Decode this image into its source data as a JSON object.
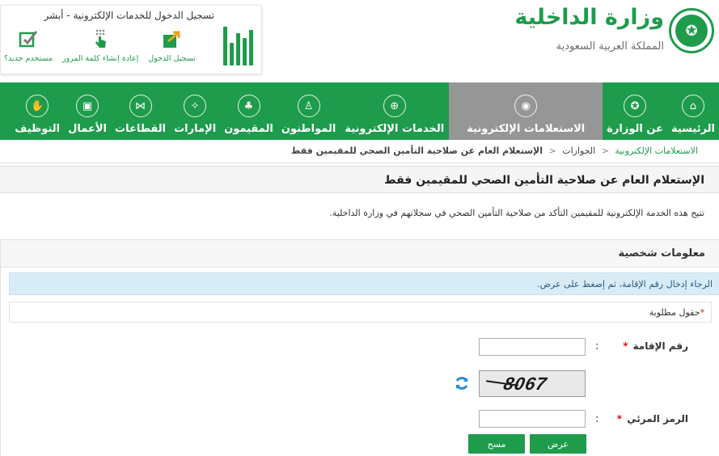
{
  "header": {
    "ministry_title": "وزارة الداخلية",
    "kingdom_title": "المملكة العربية السعودية",
    "absher": {
      "heading": "تسجيل الدخول للخدمات الإلكترونية - أبشر",
      "actions": [
        {
          "label": "مستخدم جديد؟",
          "icon": "new-user-icon"
        },
        {
          "label": "إعادة إنشاء كلمة المرور",
          "icon": "password-reset-icon"
        },
        {
          "label": "تسجيل الدخول",
          "icon": "login-icon"
        }
      ]
    }
  },
  "nav": {
    "items": [
      {
        "label": "الرئيسية",
        "icon": "home-icon",
        "glyph": "⌂",
        "active": false
      },
      {
        "label": "عن الوزارة",
        "icon": "emblem-icon",
        "glyph": "✪",
        "active": false
      },
      {
        "label": "الاستعلامات الإلكترونية",
        "icon": "inquiry-icon",
        "glyph": "◉",
        "active": true
      },
      {
        "label": "الخدمات الإلكترونية",
        "icon": "globe-icon",
        "glyph": "⊕",
        "active": false
      },
      {
        "label": "المواطنون",
        "icon": "citizen-icon",
        "glyph": "♙",
        "active": false
      },
      {
        "label": "المقيمون",
        "icon": "residents-icon",
        "glyph": "♣",
        "active": false
      },
      {
        "label": "الإمارات",
        "icon": "emirates-icon",
        "glyph": "✧",
        "active": false
      },
      {
        "label": "القطاعات",
        "icon": "sectors-icon",
        "glyph": "⋈",
        "active": false
      },
      {
        "label": "الأعمال",
        "icon": "briefcase-icon",
        "glyph": "▣",
        "active": false
      },
      {
        "label": "التوظيف",
        "icon": "employment-icon",
        "glyph": "✋",
        "active": false
      }
    ]
  },
  "breadcrumb": {
    "home": "الاستعلامات الإلكترونية",
    "section": "الجوازات",
    "current": "الإستعلام العام عن صلاحية التأمين الصحي للمقيمين فقط"
  },
  "page": {
    "title": "الإستعلام العام عن صلاحية التأمين الصحي للمقيمين فقط",
    "description": "تتيح هذه الخدمة الإلكترونية للمقيمين التأكد من صلاحية التأمين الصحي في سجلاتهم في وزارة الداخلية."
  },
  "form": {
    "panel_title": "معلومات شخصية",
    "info": "الرجاء إدخال رقم الإقامة، ثم إضغط على عرض.",
    "required_note": "حقول مطلوبة",
    "iqama_label": "رقم الإقامة",
    "iqama_value": "",
    "captcha_text": "8067",
    "captcha_label": "الرمز المرئي",
    "captcha_value": "",
    "submit_label": "عرض",
    "clear_label": "مسح"
  },
  "colors": {
    "brand_green": "#1e9c4c",
    "active_nav": "#969696",
    "info_bg": "#d8ecf7"
  }
}
